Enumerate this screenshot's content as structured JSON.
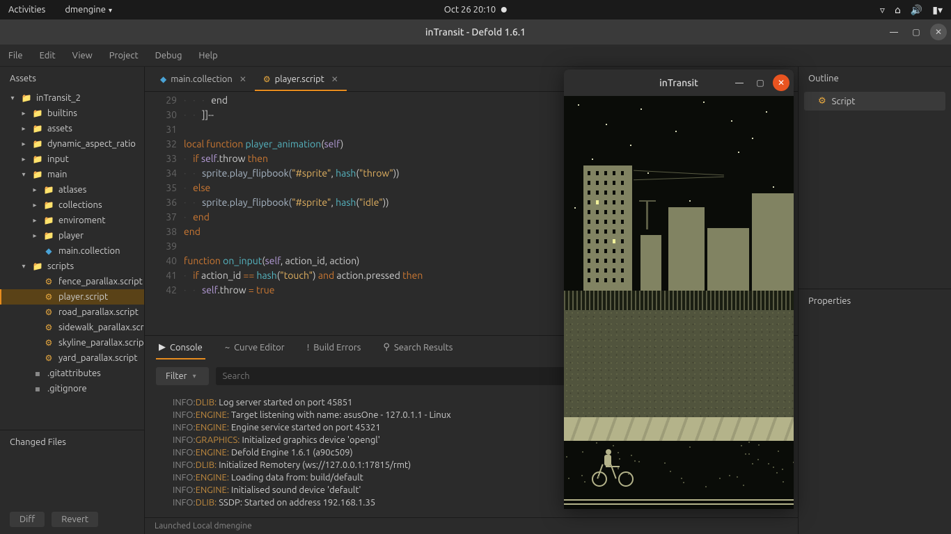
{
  "panel": {
    "activities": "Activities",
    "app": "dmengine",
    "datetime": "Oct 26  20:10"
  },
  "window": {
    "title": "inTransit - Defold 1.6.1"
  },
  "menu": [
    "File",
    "Edit",
    "View",
    "Project",
    "Debug",
    "Help"
  ],
  "assets": {
    "header": "Assets",
    "root": "inTransit_2",
    "items": [
      {
        "label": "builtins",
        "type": "folder",
        "indent": 1,
        "arrow": "▸"
      },
      {
        "label": "assets",
        "type": "folder",
        "indent": 1,
        "arrow": "▸"
      },
      {
        "label": "dynamic_aspect_ratio",
        "type": "folder",
        "indent": 1,
        "arrow": "▸"
      },
      {
        "label": "input",
        "type": "folder",
        "indent": 1,
        "arrow": "▸"
      },
      {
        "label": "main",
        "type": "folder",
        "indent": 1,
        "arrow": "▾"
      },
      {
        "label": "atlases",
        "type": "folder",
        "indent": 2,
        "arrow": "▸"
      },
      {
        "label": "collections",
        "type": "folder",
        "indent": 2,
        "arrow": "▸"
      },
      {
        "label": "enviroment",
        "type": "folder",
        "indent": 2,
        "arrow": "▸"
      },
      {
        "label": "player",
        "type": "folder",
        "indent": 2,
        "arrow": "▸"
      },
      {
        "label": "main.collection",
        "type": "collection",
        "indent": 2,
        "arrow": ""
      },
      {
        "label": "scripts",
        "type": "folder",
        "indent": 1,
        "arrow": "▾"
      },
      {
        "label": "fence_parallax.script",
        "type": "script",
        "indent": 2,
        "arrow": ""
      },
      {
        "label": "player.script",
        "type": "script",
        "indent": 2,
        "arrow": "",
        "active": true
      },
      {
        "label": "road_parallax.script",
        "type": "script",
        "indent": 2,
        "arrow": ""
      },
      {
        "label": "sidewalk_parallax.scr",
        "type": "script",
        "indent": 2,
        "arrow": ""
      },
      {
        "label": "skyline_parallax.scrip",
        "type": "script",
        "indent": 2,
        "arrow": ""
      },
      {
        "label": "yard_parallax.script",
        "type": "script",
        "indent": 2,
        "arrow": ""
      },
      {
        "label": ".gitattributes",
        "type": "file",
        "indent": 1,
        "arrow": ""
      },
      {
        "label": ".gitignore",
        "type": "file",
        "indent": 1,
        "arrow": ""
      }
    ],
    "changed_header": "Changed Files",
    "diff": "Diff",
    "revert": "Revert"
  },
  "tabs": [
    {
      "label": "main.collection",
      "icon": "coll",
      "active": false
    },
    {
      "label": "player.script",
      "icon": "gear",
      "active": true
    }
  ],
  "code": {
    "start": 29,
    "lines": [
      {
        "n": 29,
        "ind": 3,
        "frags": [
          {
            "t": "end",
            "c": "id"
          }
        ]
      },
      {
        "n": 30,
        "ind": 2,
        "frags": [
          {
            "t": "]]--",
            "c": "id"
          }
        ]
      },
      {
        "n": 31,
        "ind": 0,
        "frags": []
      },
      {
        "n": 32,
        "ind": 0,
        "frags": [
          {
            "t": "local ",
            "c": "kw"
          },
          {
            "t": "function ",
            "c": "kw"
          },
          {
            "t": "player_animation",
            "c": "fn"
          },
          {
            "t": "(",
            "c": "punc"
          },
          {
            "t": "self",
            "c": "self"
          },
          {
            "t": ")",
            "c": "punc"
          }
        ]
      },
      {
        "n": 33,
        "ind": 1,
        "frags": [
          {
            "t": "if ",
            "c": "kw"
          },
          {
            "t": "self",
            "c": "self"
          },
          {
            "t": ".throw ",
            "c": "id"
          },
          {
            "t": "then",
            "c": "kw"
          }
        ]
      },
      {
        "n": 34,
        "ind": 2,
        "frags": [
          {
            "t": "sprite.play_flipbook(",
            "c": "call"
          },
          {
            "t": "\"#sprite\"",
            "c": "str"
          },
          {
            "t": ", ",
            "c": "punc"
          },
          {
            "t": "hash",
            "c": "hash"
          },
          {
            "t": "(",
            "c": "punc"
          },
          {
            "t": "\"throw\"",
            "c": "str"
          },
          {
            "t": "))",
            "c": "punc"
          }
        ]
      },
      {
        "n": 35,
        "ind": 1,
        "frags": [
          {
            "t": "else",
            "c": "kw"
          }
        ]
      },
      {
        "n": 36,
        "ind": 2,
        "frags": [
          {
            "t": "sprite.play_flipbook(",
            "c": "call"
          },
          {
            "t": "\"#sprite\"",
            "c": "str"
          },
          {
            "t": ", ",
            "c": "punc"
          },
          {
            "t": "hash",
            "c": "hash"
          },
          {
            "t": "(",
            "c": "punc"
          },
          {
            "t": "\"idle\"",
            "c": "str"
          },
          {
            "t": "))",
            "c": "punc"
          }
        ]
      },
      {
        "n": 37,
        "ind": 1,
        "frags": [
          {
            "t": "end",
            "c": "kw"
          }
        ]
      },
      {
        "n": 38,
        "ind": 0,
        "frags": [
          {
            "t": "end",
            "c": "kw"
          }
        ]
      },
      {
        "n": 39,
        "ind": 0,
        "frags": []
      },
      {
        "n": 40,
        "ind": 0,
        "frags": [
          {
            "t": "function ",
            "c": "kw"
          },
          {
            "t": "on_input",
            "c": "fn"
          },
          {
            "t": "(",
            "c": "punc"
          },
          {
            "t": "self",
            "c": "self"
          },
          {
            "t": ", action_id, action)",
            "c": "id"
          }
        ]
      },
      {
        "n": 41,
        "ind": 1,
        "frags": [
          {
            "t": "if ",
            "c": "kw"
          },
          {
            "t": "action_id ",
            "c": "id"
          },
          {
            "t": "== ",
            "c": "op"
          },
          {
            "t": "hash",
            "c": "hash"
          },
          {
            "t": "(",
            "c": "punc"
          },
          {
            "t": "\"touch\"",
            "c": "str"
          },
          {
            "t": ") ",
            "c": "punc"
          },
          {
            "t": "and ",
            "c": "kw"
          },
          {
            "t": "action.pressed ",
            "c": "id"
          },
          {
            "t": "then",
            "c": "kw"
          }
        ]
      },
      {
        "n": 42,
        "ind": 2,
        "frags": [
          {
            "t": "self",
            "c": "self"
          },
          {
            "t": ".throw ",
            "c": "id"
          },
          {
            "t": "= ",
            "c": "op"
          },
          {
            "t": "true",
            "c": "kw"
          }
        ]
      }
    ]
  },
  "bottomTabs": [
    {
      "label": "Console",
      "icon": "▶",
      "active": true
    },
    {
      "label": "Curve Editor",
      "icon": "~",
      "active": false
    },
    {
      "label": "Build Errors",
      "icon": "!",
      "active": false
    },
    {
      "label": "Search Results",
      "icon": "⚲",
      "active": false
    }
  ],
  "filter": {
    "btn": "Filter",
    "placeholder": "Search"
  },
  "console": [
    {
      "tag": "DLIB",
      "msg": "Log server started on port 45851"
    },
    {
      "tag": "ENGINE",
      "msg": "Target listening with name: asusOne - 127.0.1.1 - Linux"
    },
    {
      "tag": "ENGINE",
      "msg": "Engine service started on port 45321"
    },
    {
      "tag": "GRAPHICS",
      "msg": "Initialized graphics device 'opengl'"
    },
    {
      "tag": "ENGINE",
      "msg": "Defold Engine 1.6.1 (a90c509)"
    },
    {
      "tag": "DLIB",
      "msg": "Initialized Remotery (ws://127.0.0.1:17815/rmt)"
    },
    {
      "tag": "ENGINE",
      "msg": "Loading data from: build/default"
    },
    {
      "tag": "ENGINE",
      "msg": "Initialised sound device 'default'"
    },
    {
      "tag": "DLIB",
      "msg": "SSDP: Started on address 192.168.1.35"
    }
  ],
  "statusbar": "Launched Local dmengine",
  "outline": {
    "header": "Outline",
    "item": "Script"
  },
  "properties": {
    "header": "Properties"
  },
  "game": {
    "title": "inTransit"
  }
}
